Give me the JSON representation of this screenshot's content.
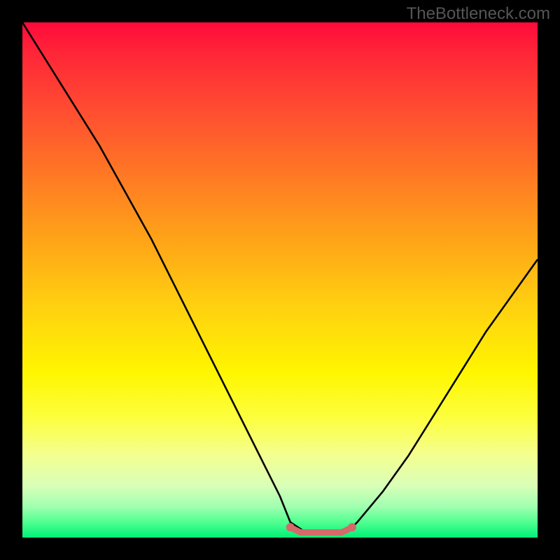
{
  "watermark": "TheBottleneck.com",
  "chart_data": {
    "type": "line",
    "title": "",
    "xlabel": "",
    "ylabel": "",
    "xlim": [
      0,
      100
    ],
    "ylim": [
      0,
      100
    ],
    "series": [
      {
        "name": "curve",
        "x": [
          0,
          5,
          10,
          15,
          20,
          25,
          30,
          35,
          40,
          45,
          50,
          52,
          55,
          58,
          60,
          63,
          65,
          70,
          75,
          80,
          85,
          90,
          95,
          100
        ],
        "values": [
          100,
          92,
          84,
          76,
          67,
          58,
          48,
          38,
          28,
          18,
          8,
          3,
          1,
          1,
          1,
          1,
          3,
          9,
          16,
          24,
          32,
          40,
          47,
          54
        ]
      },
      {
        "name": "flat-marker",
        "x": [
          52,
          54,
          56,
          58,
          60,
          62,
          64
        ],
        "values": [
          2,
          1,
          1,
          1,
          1,
          1,
          2
        ]
      }
    ],
    "gradient_stops": [
      {
        "pos": 0.0,
        "color": "#ff0a3a"
      },
      {
        "pos": 0.18,
        "color": "#ff5030"
      },
      {
        "pos": 0.42,
        "color": "#ffa318"
      },
      {
        "pos": 0.68,
        "color": "#fff600"
      },
      {
        "pos": 0.9,
        "color": "#d8ffb8"
      },
      {
        "pos": 1.0,
        "color": "#00f078"
      }
    ]
  }
}
